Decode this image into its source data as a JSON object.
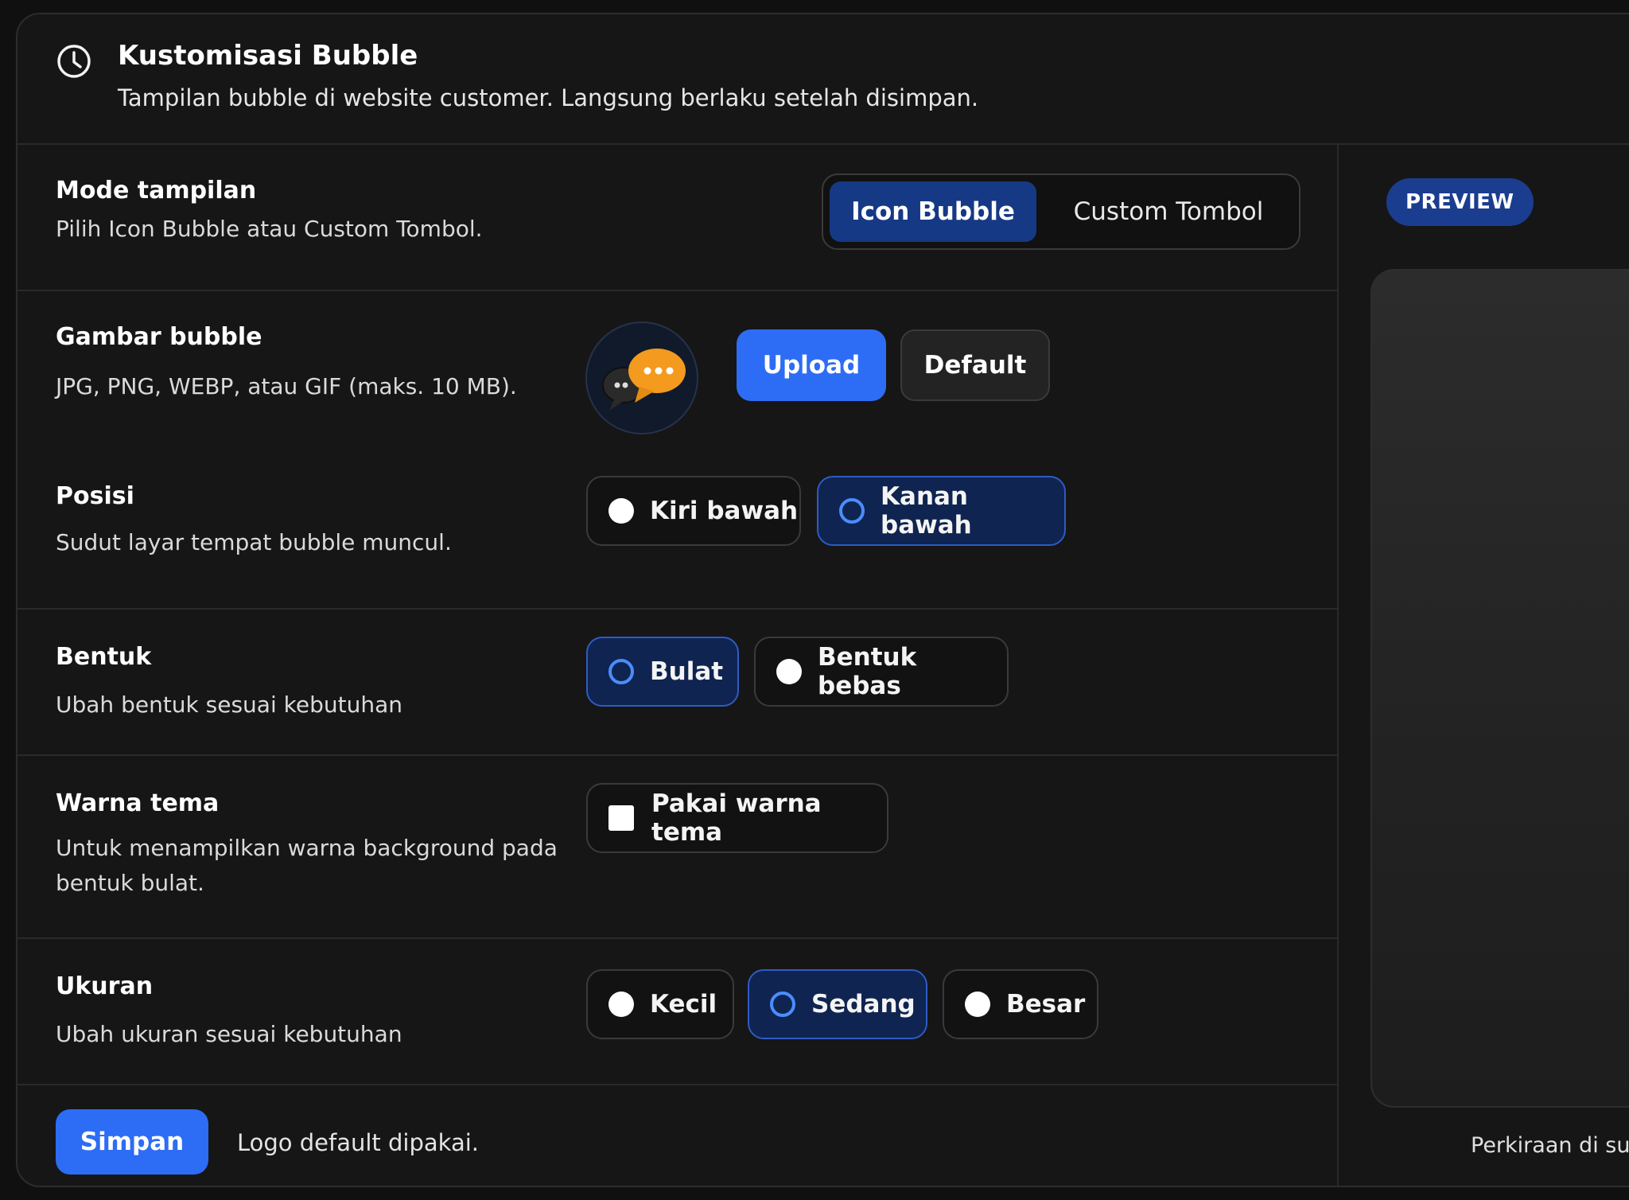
{
  "header": {
    "title": "Kustomisasi Bubble",
    "subtitle": "Tampilan bubble di website customer. Langsung berlaku setelah disimpan."
  },
  "mode": {
    "title": "Mode tampilan",
    "desc": "Pilih Icon Bubble atau Custom Tombol.",
    "options": [
      "Icon Bubble",
      "Custom Tombol"
    ],
    "selected": "Icon Bubble"
  },
  "image": {
    "title": "Gambar bubble",
    "desc": "JPG, PNG, WEBP, atau GIF (maks. 10 MB).",
    "upload_label": "Upload",
    "default_label": "Default"
  },
  "position": {
    "title": "Posisi",
    "desc": "Sudut layar tempat bubble muncul.",
    "options": [
      "Kiri bawah",
      "Kanan bawah"
    ],
    "selected": "Kanan bawah"
  },
  "shape": {
    "title": "Bentuk",
    "desc": "Ubah bentuk sesuai kebutuhan",
    "options": [
      "Bulat",
      "Bentuk bebas"
    ],
    "selected": "Bulat"
  },
  "theme": {
    "title": "Warna tema",
    "desc_line1": "Untuk menampilkan warna background pada",
    "desc_line2": "bentuk bulat.",
    "checkbox_label": "Pakai warna tema",
    "checked": false
  },
  "size": {
    "title": "Ukuran",
    "desc": "Ubah ukuran sesuai kebutuhan",
    "options": [
      "Kecil",
      "Sedang",
      "Besar"
    ],
    "selected": "Sedang"
  },
  "footer": {
    "save_label": "Simpan",
    "message": "Logo default dipakai."
  },
  "preview": {
    "badge": "PREVIEW",
    "note": "Perkiraan di sudu"
  },
  "colors": {
    "primary": "#2d6df5",
    "selected_bg": "#0f2450",
    "selected_border": "#2e5bc4",
    "badge": "#1b3d8f"
  },
  "icons": {
    "header": "clock-icon",
    "bubble_image": "chat-bubbles-icon"
  }
}
